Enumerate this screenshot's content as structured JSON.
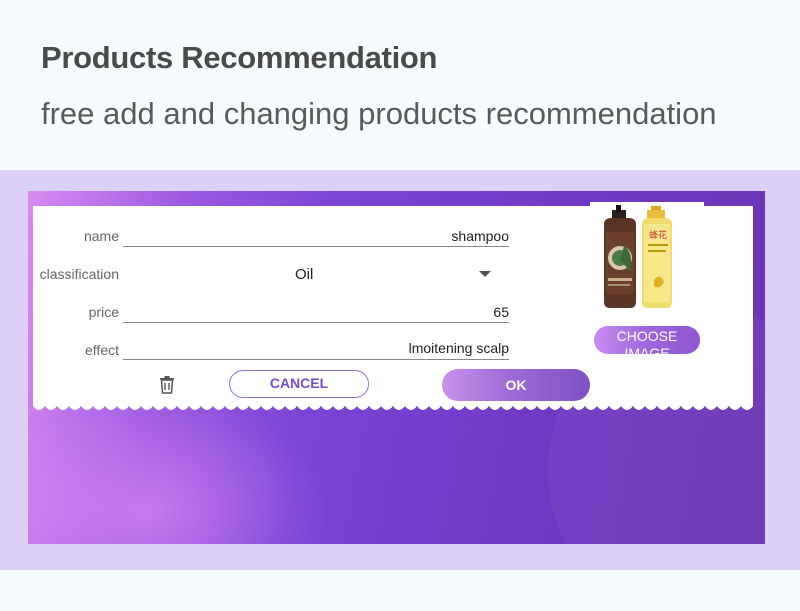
{
  "header": {
    "title": "Products Recommendation",
    "subtitle": "free add and changing products recommendation"
  },
  "form": {
    "name": {
      "label": "name",
      "value": "shampoo"
    },
    "classification": {
      "label": "classification",
      "value": "Oil"
    },
    "price": {
      "label": "price",
      "value": "65"
    },
    "effect": {
      "label": "effect",
      "value": "lmoitening scalp"
    }
  },
  "product_image": {
    "choose_label": "CHOOSE IMAGE",
    "bottle1_label": "",
    "bottle2_label": "蜂花"
  },
  "actions": {
    "cancel_label": "CANCEL",
    "ok_label": "OK"
  },
  "colors": {
    "accent": "#7a44d6",
    "band": "#ddd0f8"
  }
}
